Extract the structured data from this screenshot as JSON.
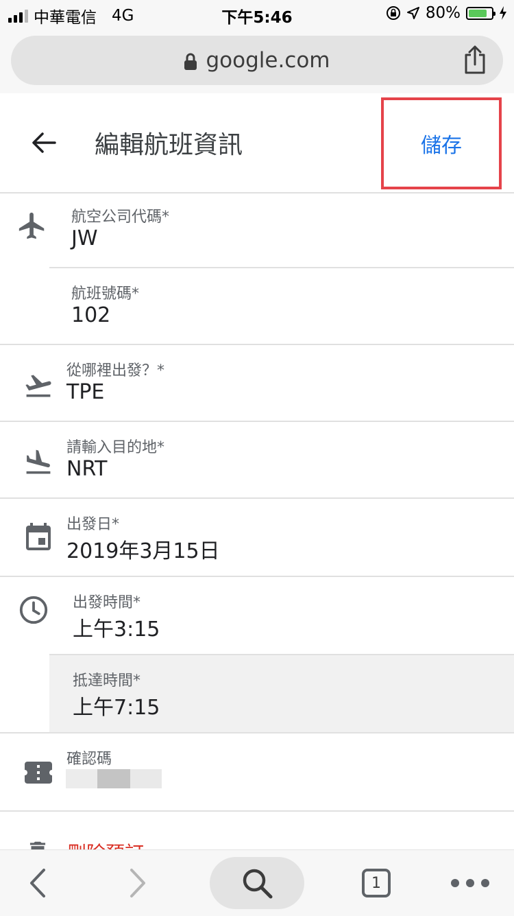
{
  "status_bar": {
    "carrier": "中華電信",
    "network": "4G",
    "time": "下午5:46",
    "battery_percent": "80%",
    "battery_level": 0.8
  },
  "browser": {
    "url": "google.com"
  },
  "header": {
    "title": "編輯航班資訊",
    "save_label": "儲存"
  },
  "fields": {
    "airline_code": {
      "label": "航空公司代碼*",
      "value": "JW"
    },
    "flight_number": {
      "label": "航班號碼*",
      "value": "102"
    },
    "origin": {
      "label": "從哪裡出發？*",
      "value": "TPE"
    },
    "destination": {
      "label": "請輸入目的地*",
      "value": "NRT"
    },
    "departure_date": {
      "label": "出發日*",
      "value": "2019年3月15日"
    },
    "departure_time": {
      "label": "出發時間*",
      "value": "上午3:15"
    },
    "arrival_time": {
      "label": "抵達時間*",
      "value": "上午7:15"
    },
    "confirmation": {
      "label": "確認碼",
      "value": ""
    }
  },
  "delete_label": "刪除預訂",
  "toolbar": {
    "tab_count": "1"
  },
  "colors": {
    "accent": "#1a73e8",
    "highlight_box": "#e5434a",
    "delete": "#d93025",
    "active_row_bg": "#f1f1f1"
  }
}
